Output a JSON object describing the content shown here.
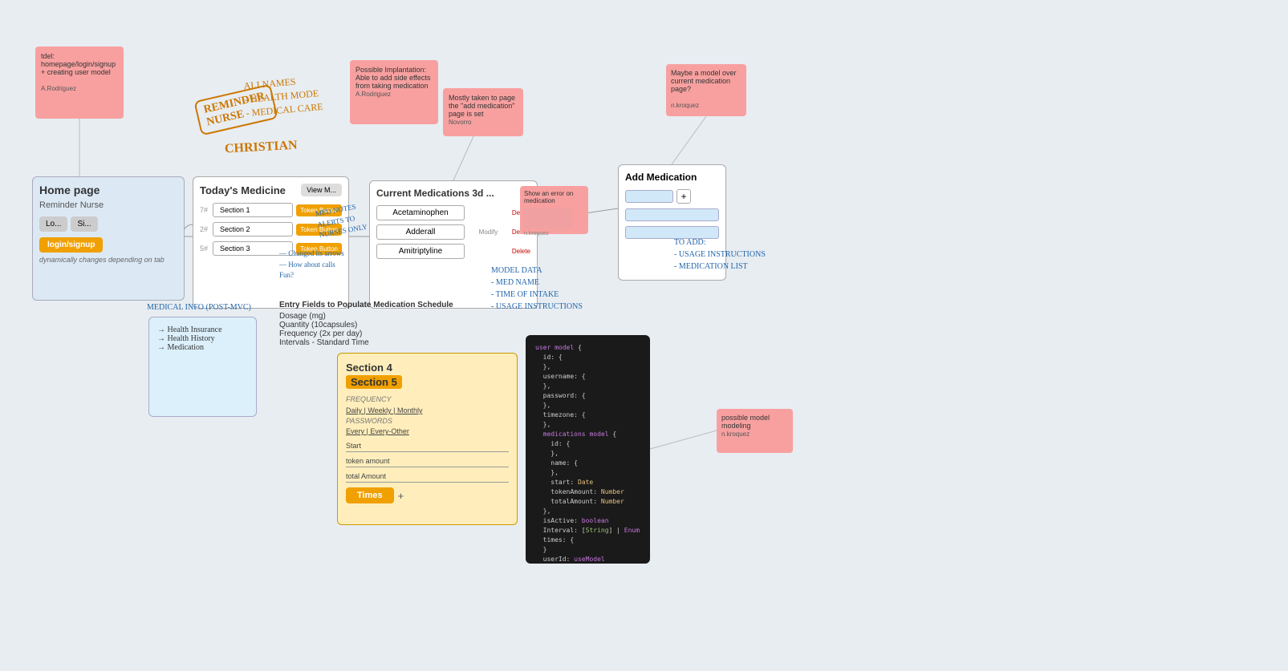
{
  "canvas": {
    "background": "#e8edf2"
  },
  "stickies": {
    "top_left": {
      "text": "tdel: homepage/login/signup + creating user model",
      "author": "A.Rodriguez"
    },
    "top_mid1": {
      "text": "Possible Implantation: Able to add side effects from taking medication",
      "author": "A.Rodriguez"
    },
    "top_mid2": {
      "text": "Mostly taken to page the \"add medication\" page is set",
      "author": "Novorro"
    },
    "maybe_model": {
      "text": "Maybe a model over current medication page?",
      "author": "n.kroquez"
    },
    "possible_model": {
      "text": "possible model modeling",
      "author": "n.kroquez"
    },
    "error_sticky": {
      "text": "Show an error on medication"
    }
  },
  "home_page": {
    "title": "Home page",
    "subtitle": "Reminder Nurse",
    "login_btn": "Lo...",
    "signup_btn": "Si...",
    "auth_btn": "login/signup",
    "auth_note": "dynamically changes depending on tab"
  },
  "todays_medicine": {
    "title": "Today's Medicine",
    "view_btn": "View M...",
    "rows": [
      {
        "num": "7#",
        "section": "Section 1",
        "token": "Token Button"
      },
      {
        "num": "2#",
        "section": "Section 2",
        "token": "Token Button"
      },
      {
        "num": "5#",
        "section": "Section 3",
        "token": "Token Button"
      }
    ]
  },
  "current_medications": {
    "title": "Current Medications",
    "medications": [
      {
        "name": "Acetaminophen",
        "info": "",
        "has_delete": true
      },
      {
        "name": "Adderall",
        "info": "Modify",
        "has_delete": true
      },
      {
        "name": "Amitriptyline",
        "info": "",
        "has_delete": true
      }
    ],
    "delete_label": "Delete"
  },
  "add_medication": {
    "title": "Add Medication"
  },
  "section45": {
    "section4_label": "Section 4",
    "section5_label": "Section 5",
    "frequency_note": "FREQUENCY",
    "time_options": "Daily | Weekly | Monthly",
    "password_note": "PASSWORDS",
    "every_options": "Every | Every-Other",
    "fields": [
      "Start",
      "token amount",
      "total Amount"
    ],
    "times_btn": "Times",
    "times_plus": "+"
  },
  "entry_fields": {
    "title": "Entry Fields to Populate Medication Schedule",
    "fields": [
      "Dosage (mg)",
      "Quantity (10capsules)",
      "Frequency (2x per day)",
      "Intervals - Standard Time"
    ]
  },
  "medical_info": {
    "title": "MEDICAL INFO (POST-MVC)",
    "items": [
      "→ Health Insurance",
      "→ Health History",
      "→ Medication"
    ]
  },
  "code_block": {
    "title": "user model {",
    "lines": [
      "user model {",
      "  id: {",
      "  },",
      "  username: {",
      "  },",
      "  password: {",
      "  },",
      "  timezone: {",
      "  },",
      "  medications model {",
      "    id: {",
      "    },",
      "    name: {",
      "    },",
      "    start: Date",
      "    tokenAmount: Number",
      "    totalAmount: Number",
      "  },",
      "  isActive: boolean",
      "  Interval: [String] | Enum",
      "  times: {",
      "  }",
      "  userId: useModel",
      "}"
    ]
  },
  "annotations": {
    "reminder_nurse": "REMINDER NURSE",
    "ali_names": "ALI NAMES\n- HEALTH MODE\n- MEDICAL CARE",
    "christian": "CHRISTIAN",
    "model_data": "MODEL DATA\n- MED NAME\n- TIME OF INTAKE\n- USAGE INSTRUCTIONS",
    "to_add": "TO ADD:\n- USAGE INSTRUCTIONS\n- MEDICATION LIST",
    "med_info_annotation": "MEDICAL INFO (POST-MVC)\n→ Health Insurance\n→ Health History\n→ Medication",
    "entry_fields_note": "— Changed its arrows\n— How about calls\nFun?"
  }
}
